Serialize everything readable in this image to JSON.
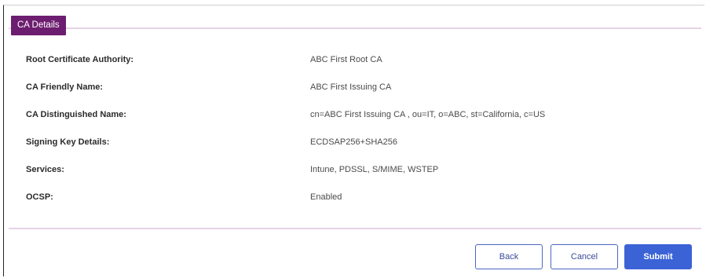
{
  "section": {
    "title": "CA Details"
  },
  "details": [
    {
      "label": "Root Certificate Authority:",
      "value": "ABC First Root CA"
    },
    {
      "label": "CA Friendly Name:",
      "value": "ABC First Issuing CA"
    },
    {
      "label": "CA Distinguished Name:",
      "value": "cn=ABC First Issuing CA , ou=IT, o=ABC, st=California, c=US"
    },
    {
      "label": "Signing Key Details:",
      "value": "ECDSAP256+SHA256"
    },
    {
      "label": "Services:",
      "value": "Intune, PDSSL, S/MIME, WSTEP"
    },
    {
      "label": "OCSP:",
      "value": "Enabled"
    }
  ],
  "actions": {
    "back_label": "Back",
    "cancel_label": "Cancel",
    "submit_label": "Submit"
  },
  "colors": {
    "accent": "#6d1d6f",
    "primary_button": "#3b63d6",
    "divider": "#e6d3e6"
  }
}
